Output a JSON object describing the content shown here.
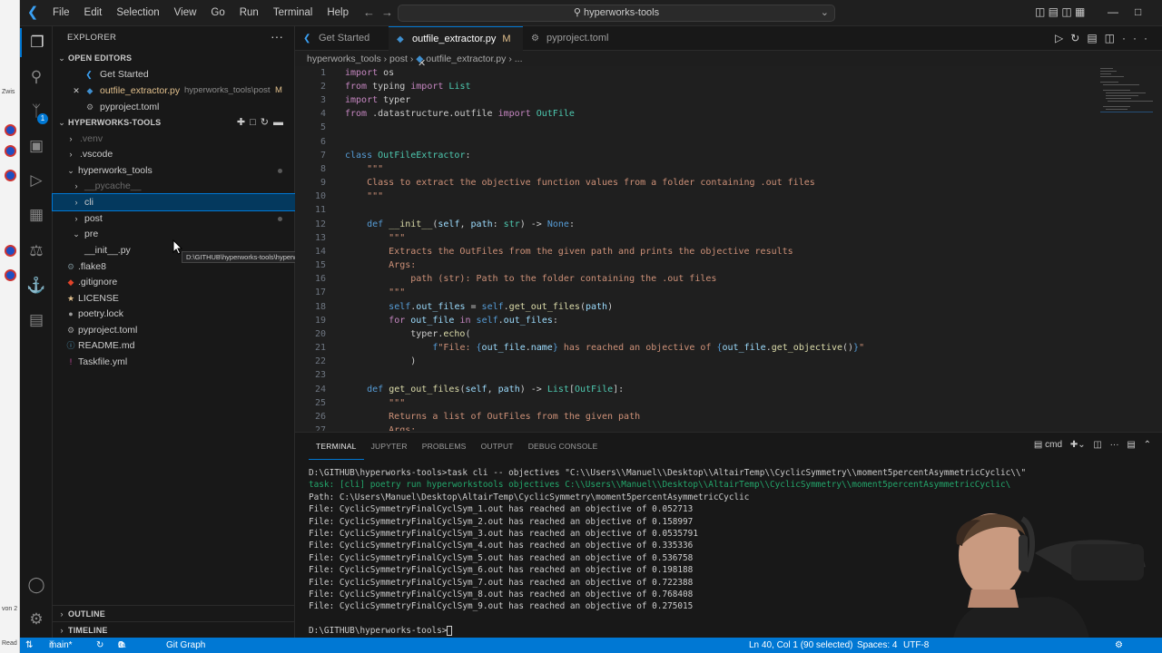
{
  "titlebar": {
    "menu": [
      "File",
      "Edit",
      "Selection",
      "View",
      "Go",
      "Run",
      "Terminal",
      "Help"
    ],
    "search": "hyperworks-tools"
  },
  "activitybar": {
    "items": [
      "files-icon",
      "search-icon",
      "source-control-icon",
      "remote-explorer-icon",
      "run-debug-icon",
      "extensions-icon",
      "testing-icon",
      "docker-icon",
      "database-icon"
    ],
    "scm_badge": "1"
  },
  "explorer": {
    "title": "EXPLORER",
    "open_editors_label": "OPEN EDITORS",
    "open_editors": [
      {
        "name": "Get Started",
        "path": ""
      },
      {
        "name": "outfile_extractor.py",
        "path": "hyperworks_tools\\post",
        "status": "M"
      },
      {
        "name": "pyproject.toml",
        "path": ""
      }
    ],
    "project_label": "HYPERWORKS-TOOLS",
    "tree": [
      ".venv",
      ".vscode",
      "hyperworks_tools",
      "__pycache__",
      "cli",
      "post",
      "pre",
      "__init__.py",
      ".flake8",
      ".gitignore",
      "LICENSE",
      "poetry.lock",
      "pyproject.toml",
      "README.md",
      "Taskfile.yml"
    ],
    "tooltip": "D:\\GITHUB\\hyperworks-tools\\hyperworks_tools\\pre",
    "outline_label": "OUTLINE",
    "timeline_label": "TIMELINE"
  },
  "tabs": [
    {
      "label": "Get Started",
      "status": ""
    },
    {
      "label": "outfile_extractor.py",
      "status": "M"
    },
    {
      "label": "pyproject.toml",
      "status": ""
    }
  ],
  "breadcrumb": [
    "hyperworks_tools",
    "post",
    "outfile_extractor.py",
    "..."
  ],
  "editor": {
    "line_numbers": [
      "1",
      "2",
      "3",
      "4",
      "5",
      "6",
      "7",
      "8",
      "9",
      "10",
      "11",
      "12",
      "13",
      "14",
      "15",
      "16",
      "17",
      "18",
      "19",
      "20",
      "21",
      "22",
      "23",
      "24",
      "25",
      "26",
      "27"
    ]
  },
  "panel": {
    "tabs": [
      "TERMINAL",
      "JUPYTER",
      "PROBLEMS",
      "OUTPUT",
      "DEBUG CONSOLE"
    ],
    "shell": "cmd",
    "terminal_lines": [
      "D:\\GITHUB\\hyperworks-tools>task cli -- objectives \"C:\\\\Users\\\\Manuel\\\\Desktop\\\\AltairTemp\\\\CyclicSymmetry\\\\moment5percentAsymmetricCyclic\\\\\"",
      "task: [cli] poetry run hyperworkstools objectives C:\\\\Users\\\\Manuel\\\\Desktop\\\\AltairTemp\\\\CyclicSymmetry\\\\moment5percentAsymmetricCyclic\\",
      "Path: C:\\Users\\Manuel\\Desktop\\AltairTemp\\CyclicSymmetry\\moment5percentAsymmetricCyclic",
      "File: CyclicSymmetryFinalCyclSym_1.out has reached an objective of 0.052713",
      "File: CyclicSymmetryFinalCyclSym_2.out has reached an objective of 0.158997",
      "File: CyclicSymmetryFinalCyclSym_3.out has reached an objective of 0.0535791",
      "File: CyclicSymmetryFinalCyclSym_4.out has reached an objective of 0.335336",
      "File: CyclicSymmetryFinalCyclSym_5.out has reached an objective of 0.536758",
      "File: CyclicSymmetryFinalCyclSym_6.out has reached an objective of 0.198188",
      "File: CyclicSymmetryFinalCyclSym_7.out has reached an objective of 0.722388",
      "File: CyclicSymmetryFinalCyclSym_8.out has reached an objective of 0.768408",
      "File: CyclicSymmetryFinalCyclSym_9.out has reached an objective of 0.275015",
      "",
      "D:\\GITHUB\\hyperworks-tools>"
    ]
  },
  "statusbar": {
    "branch": "main*",
    "problems": "0",
    "warnings": "0",
    "git_graph": "Git Graph",
    "position": "Ln 40, Col 1 (90 selected)",
    "spaces": "Spaces: 4",
    "encoding": "UTF-8"
  }
}
